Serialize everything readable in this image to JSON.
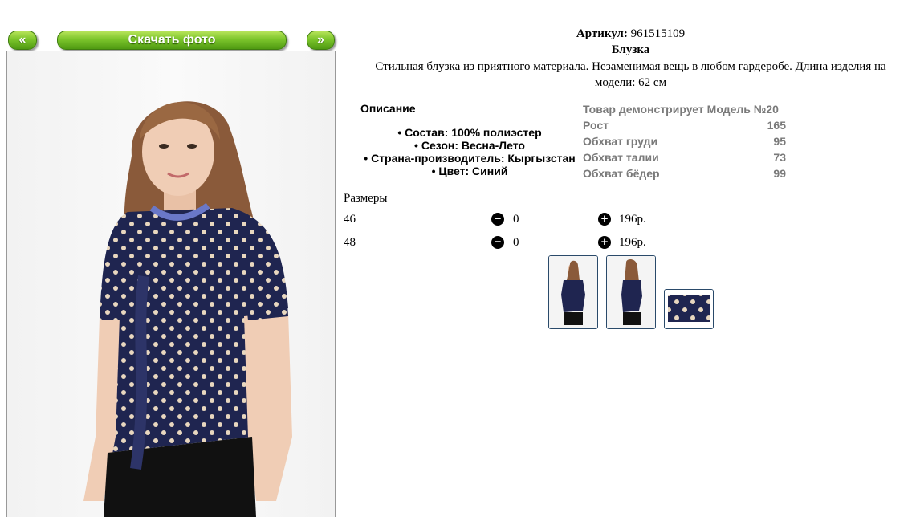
{
  "nav": {
    "prev_label": "«",
    "download_label": "Скачать фото",
    "next_label": "»"
  },
  "product": {
    "article_label": "Артикул:",
    "article_value": "961515109",
    "name": "Блузка",
    "desc_line1": "Стильная блузка из приятного материала. Незаменимая вещь в любом гардеробе. Длина изделия на",
    "desc_line2": "модели: 62 см"
  },
  "description": {
    "title": "Описание",
    "items": [
      "Состав: 100% полиэстер",
      "Сезон: Весна-Лето",
      "Страна-производитель: Кыргызстан",
      "Цвет: Синий"
    ]
  },
  "model": {
    "header": "Товар демонстрирует Модель №20",
    "rows": [
      {
        "label": "Рост",
        "value": "165"
      },
      {
        "label": "Обхват груди",
        "value": "95"
      },
      {
        "label": "Обхват талии",
        "value": "73"
      },
      {
        "label": "Обхват бёдер",
        "value": "99"
      }
    ]
  },
  "sizes": {
    "title": "Размеры",
    "rows": [
      {
        "size": "46",
        "qty": "0",
        "price": "196р."
      },
      {
        "size": "48",
        "qty": "0",
        "price": "196р."
      }
    ]
  },
  "colors": {
    "green": "#7cc52b",
    "navy": "#1f2550",
    "dot": "#e8d7bf",
    "grey_text": "#7a7a7a"
  },
  "icons": {
    "minus": "minus-circle-icon",
    "plus": "plus-circle-icon"
  }
}
